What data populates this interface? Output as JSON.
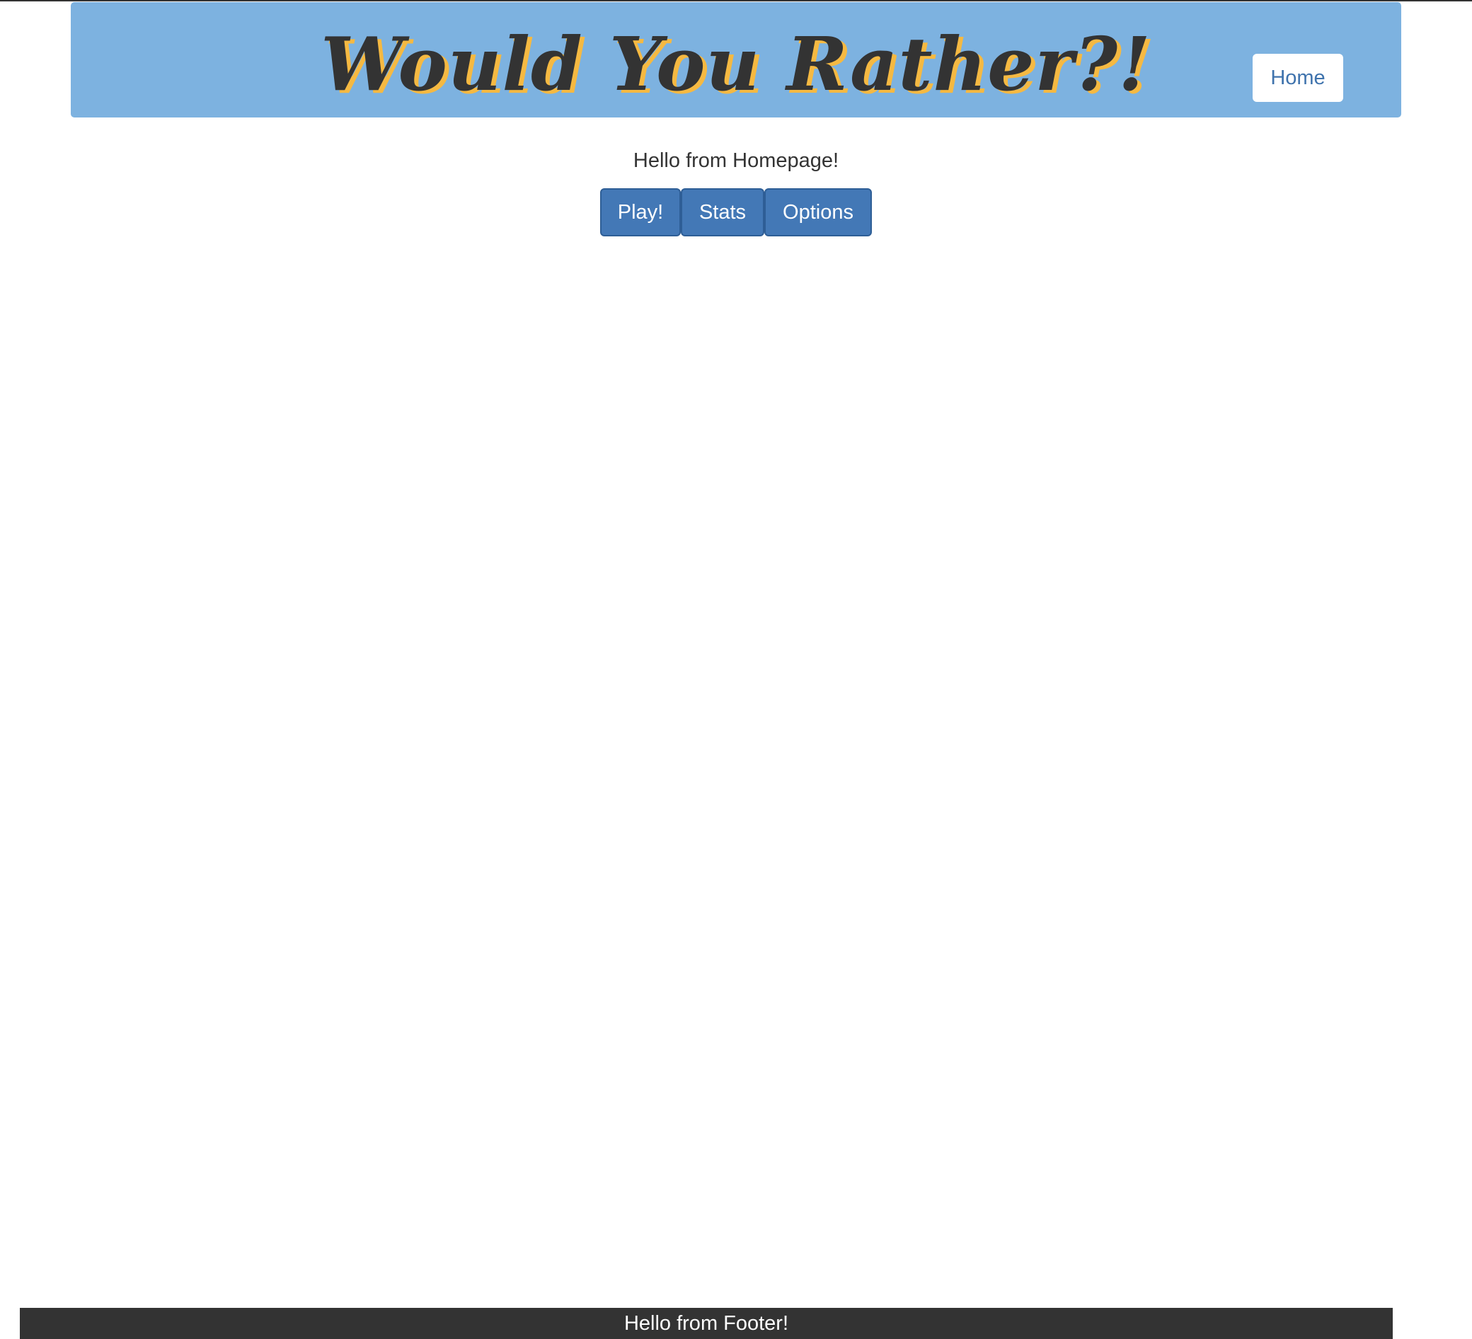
{
  "header": {
    "title": "Would You Rather?!",
    "nav_home_label": "Home"
  },
  "main": {
    "greeting": "Hello from Homepage!",
    "buttons": [
      {
        "label": "Play!"
      },
      {
        "label": "Stats"
      },
      {
        "label": "Options"
      }
    ]
  },
  "footer": {
    "text": "Hello from Footer!"
  },
  "colors": {
    "header_bg": "#7db2e0",
    "title_text": "#333333",
    "title_shadow": "#f5b942",
    "button_bg": "#4378b6",
    "footer_bg": "#333333"
  }
}
